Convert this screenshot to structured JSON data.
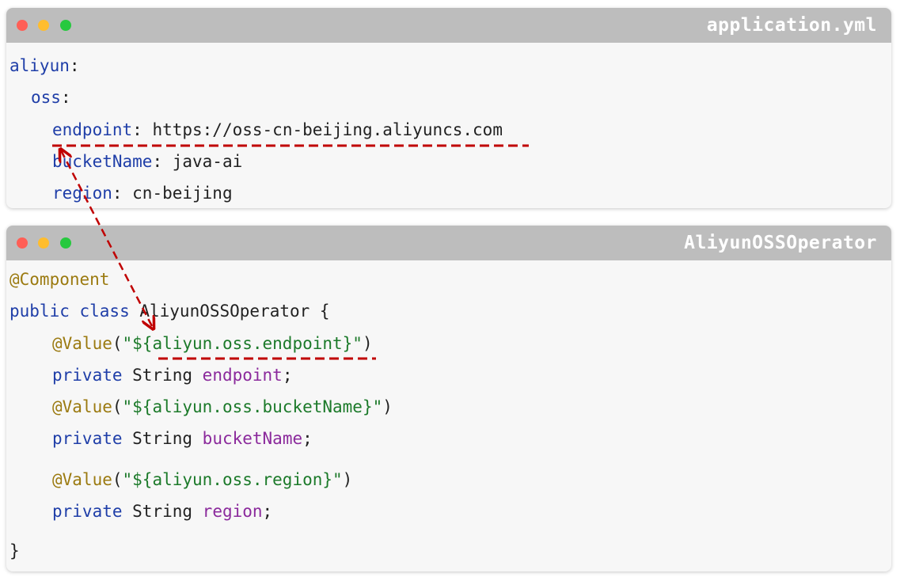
{
  "yml_window": {
    "title": "application.yml",
    "lines": {
      "l1_key": "aliyun",
      "l1_colon": ":",
      "l2_key": "oss",
      "l2_colon": ":",
      "l3_key": "endpoint",
      "l3_sep": ": ",
      "l3_val": "https://oss-cn-beijing.aliyuncs.com",
      "l4_key": "bucketName",
      "l4_sep": ": ",
      "l4_val": "java-ai",
      "l5_key": "region",
      "l5_sep": ": ",
      "l5_val": "cn-beijing"
    }
  },
  "java_window": {
    "title": "AliyunOSSOperator",
    "lines": {
      "l1": "@Component",
      "l2_kw": "public class",
      "l2_rest": " AliyunOSSOperator {",
      "l3_ann": "@Value",
      "l3_open": "(",
      "l3_str": "\"${aliyun.oss.endpoint}\"",
      "l3_close": ")",
      "l4_kw": "private",
      "l4_type": " String ",
      "l4_field": "endpoint",
      "l4_end": ";",
      "l5_ann": "@Value",
      "l5_open": "(",
      "l5_str": "\"${aliyun.oss.bucketName}\"",
      "l5_close": ")",
      "l6_kw": "private",
      "l6_type": " String ",
      "l6_field": "bucketName",
      "l6_end": ";",
      "l7_ann": "@Value",
      "l7_open": "(",
      "l7_str": "\"${aliyun.oss.region}\"",
      "l7_close": ")",
      "l8_kw": "private",
      "l8_type": " String ",
      "l8_field": "region",
      "l8_end": ";",
      "l9": "}"
    }
  },
  "colors": {
    "key_blue": "#1f3ea8",
    "annotation_gold": "#9b7a10",
    "string_green": "#1c7a2a",
    "field_purple": "#8b2a9c",
    "connector_red": "#c00000",
    "titlebar_gray": "#bdbdbd"
  },
  "icons": [
    "window-close-dot",
    "window-minimize-dot",
    "window-zoom-dot",
    "dashed-arrow"
  ]
}
